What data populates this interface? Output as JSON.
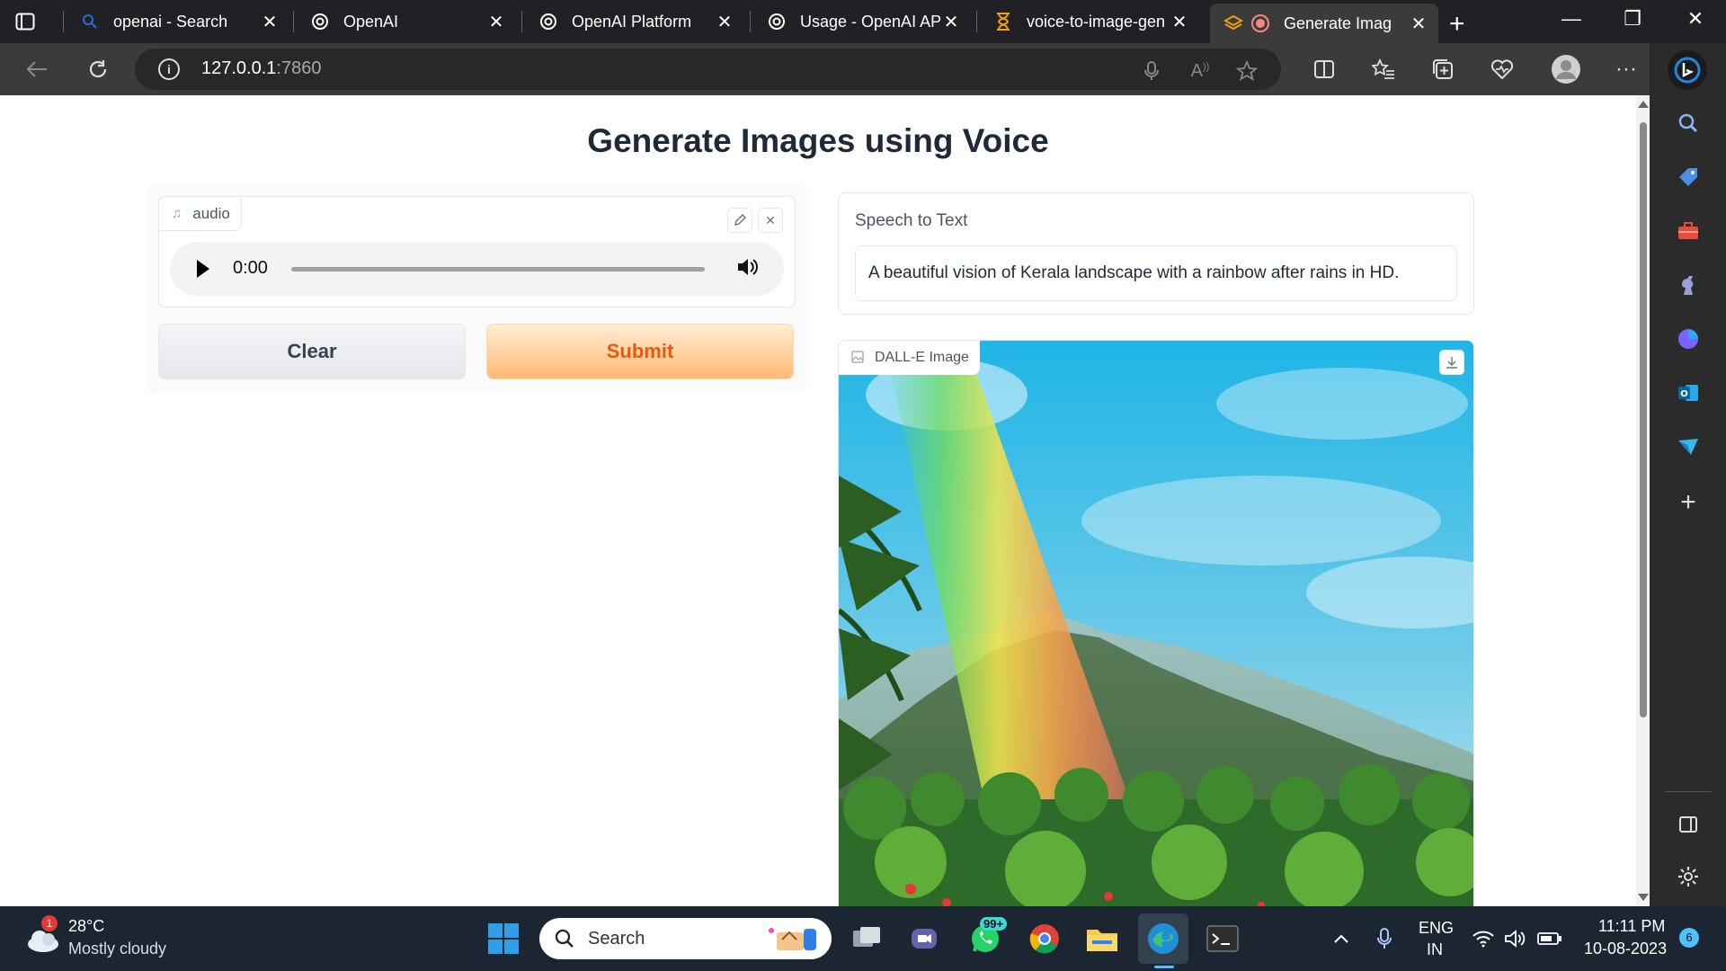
{
  "browser": {
    "tabs": [
      {
        "title": "openai - Search"
      },
      {
        "title": "OpenAI"
      },
      {
        "title": "OpenAI Platform"
      },
      {
        "title": "Usage - OpenAI API"
      },
      {
        "title": "voice-to-image-gen"
      },
      {
        "title": "Generate Imag"
      }
    ],
    "url_host": "127.0.0.1",
    "url_port": ":7860"
  },
  "app": {
    "title": "Generate Images using Voice",
    "audio": {
      "label": "audio",
      "time": "0:00"
    },
    "clear_label": "Clear",
    "submit_label": "Submit",
    "speech_to_text": {
      "label": "Speech to Text",
      "value": "A beautiful vision of Kerala landscape with a rainbow after rains in HD."
    },
    "image": {
      "label": "DALL-E Image"
    }
  },
  "taskbar": {
    "weather_badge": "1",
    "temperature": "28°C",
    "weather": "Mostly cloudy",
    "search_label": "Search",
    "whatsapp_badge": "99+",
    "lang_top": "ENG",
    "lang_bottom": "IN",
    "time": "11:11 PM",
    "date": "10-08-2023",
    "notif_count": "6"
  },
  "colors": {
    "submit_text": "#ea580c",
    "submit_bg": "#fdba74",
    "title_text": "#1f2937"
  }
}
